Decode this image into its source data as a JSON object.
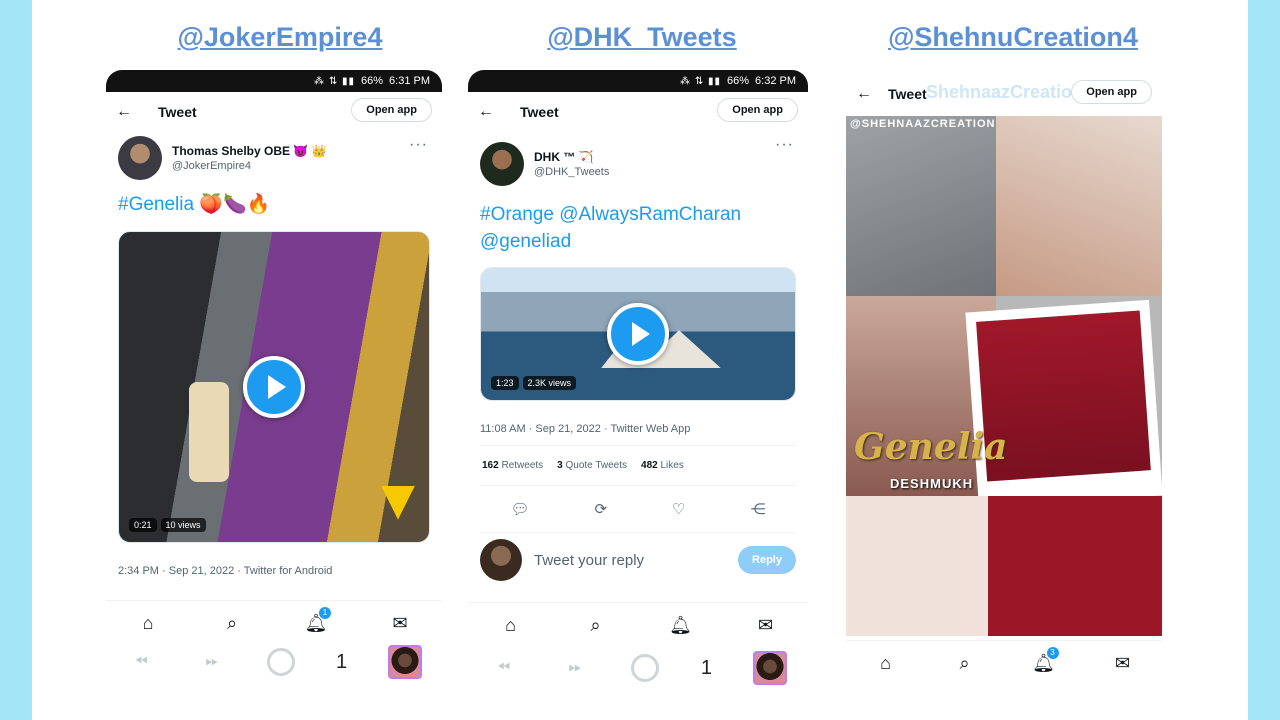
{
  "handles": [
    "@JokerEmpire4",
    "@DHK_Tweets",
    "@ShehnuCreation4"
  ],
  "colors": {
    "handle": "#5b8fd6",
    "side_bars": "#a4e6f7",
    "twitter_blue": "#1d9bf0"
  },
  "phone1": {
    "status": {
      "battery": "66%",
      "time": "6:31 PM"
    },
    "topbar": {
      "title": "Tweet",
      "open_app": "Open app"
    },
    "author": {
      "name": "Thomas Shelby OBE 😈 👑",
      "handle": "@JokerEmpire4"
    },
    "tweet_text": "#Genelia 🍑🍆🔥",
    "video": {
      "duration": "0:21",
      "views": "10 views"
    },
    "timestamp": "2:34 PM · Sep 21, 2022 · Twitter for Android",
    "sys_nav": {
      "tab_count": "1"
    }
  },
  "phone2": {
    "status": {
      "battery": "66%",
      "time": "6:32 PM"
    },
    "topbar": {
      "title": "Tweet",
      "open_app": "Open app"
    },
    "author": {
      "name": "DHK ™ 🏹",
      "handle": "@DHK_Tweets"
    },
    "tweet_text": "#Orange @AlwaysRamCharan @geneliad",
    "video": {
      "duration": "1:23",
      "views": "2.3K views"
    },
    "timestamp": "11:08 AM · Sep 21, 2022 · Twitter Web App",
    "stats": {
      "retweets_count": "162",
      "retweets_label": "Retweets",
      "quotes_count": "3",
      "quotes_label": "Quote Tweets",
      "likes_count": "482",
      "likes_label": "Likes"
    },
    "reply": {
      "placeholder": "Tweet your reply",
      "button": "Reply"
    },
    "sys_nav": {
      "tab_count": "1"
    }
  },
  "phone3": {
    "topbar": {
      "title": "Tweet",
      "open_app": "Open app",
      "overlay_text": "ShehnaazCreations"
    },
    "poster": {
      "watermark": "@SHEHNAAZCREATION",
      "script_title": "Genelia",
      "subtitle": "DESHMUKH"
    },
    "notification_badge": "3"
  },
  "nav_badges": {
    "phone1": "1",
    "phone3": "3"
  },
  "icons": [
    "back-arrow-icon",
    "home-icon",
    "search-icon",
    "bell-icon",
    "mail-icon",
    "reply-icon",
    "retweet-icon",
    "like-icon",
    "share-icon",
    "play-icon",
    "more-icon"
  ]
}
